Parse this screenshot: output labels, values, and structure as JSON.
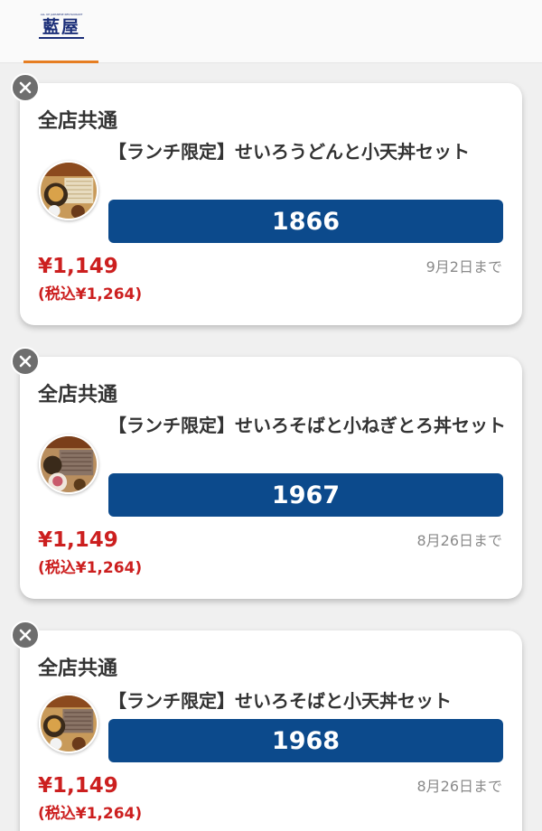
{
  "header": {
    "logo_tagline": "ALL UP JAPANESE RESTAURANT",
    "logo_text": "藍屋"
  },
  "coupons": [
    {
      "scope": "全店共通",
      "item": "【ランチ限定】せいろうどんと小天丼セット",
      "code": "1866",
      "price": "¥1,149",
      "tax_price": "(税込¥1,264)",
      "expiry": "9月2日まで"
    },
    {
      "scope": "全店共通",
      "item": "【ランチ限定】せいろそばと小ねぎとろ丼セット",
      "code": "1967",
      "price": "¥1,149",
      "tax_price": "(税込¥1,264)",
      "expiry": "8月26日まで"
    },
    {
      "scope": "全店共通",
      "item": "【ランチ限定】せいろそばと小天丼セット",
      "code": "1968",
      "price": "¥1,149",
      "tax_price": "(税込¥1,264)",
      "expiry": "8月26日まで"
    }
  ],
  "icons": {
    "close": "close-icon",
    "thumbnail": "food-thumbnail"
  },
  "colors": {
    "accent_tab": "#e67e22",
    "code_bg": "#0c4a8c",
    "price": "#cc1f1f",
    "brand": "#1b2e78"
  }
}
